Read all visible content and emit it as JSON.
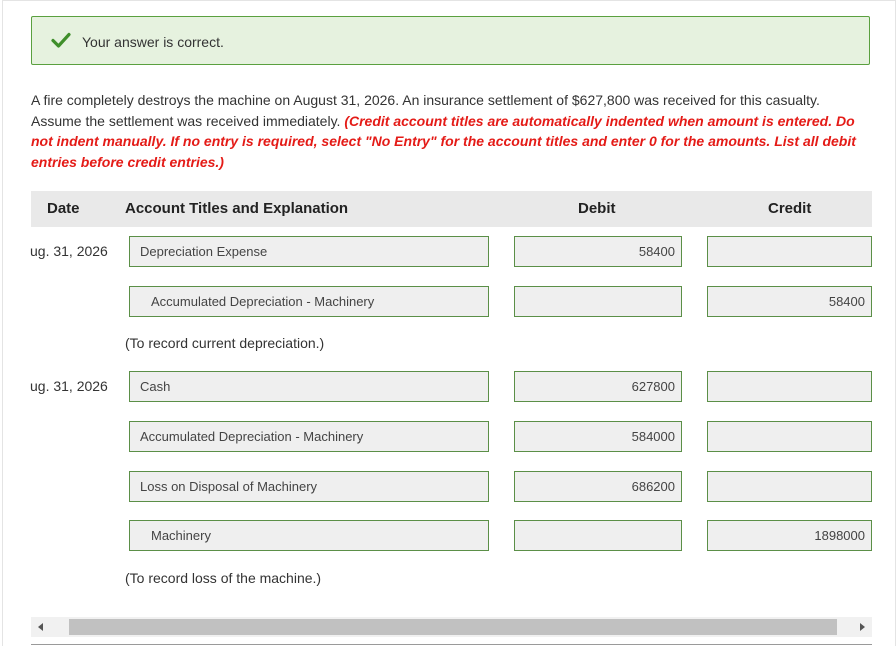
{
  "banner": {
    "message": "Your answer is correct.",
    "color": "#5aa03f"
  },
  "problem": {
    "text": "A fire completely destroys the machine on August 31, 2026. An insurance settlement of $627,800 was received for this casualty. Assume the settlement was received immediately.",
    "instructions": "(Credit account titles are automatically indented when amount is entered. Do not indent manually. If no entry is required, select \"No Entry\" for the account titles and enter 0 for the amounts. List all debit entries before credit entries.)"
  },
  "table": {
    "headers": {
      "date": "Date",
      "account": "Account Titles and Explanation",
      "debit": "Debit",
      "credit": "Credit"
    },
    "entry1": {
      "date": "ug. 31, 2026",
      "rows": [
        {
          "account": "Depreciation Expense",
          "debit": "58400",
          "credit": ""
        },
        {
          "account": "Accumulated Depreciation - Machinery",
          "debit": "",
          "credit": "58400"
        }
      ],
      "note": "(To record current depreciation.)"
    },
    "entry2": {
      "date": "ug. 31, 2026",
      "rows": [
        {
          "account": "Cash",
          "debit": "627800",
          "credit": ""
        },
        {
          "account": "Accumulated Depreciation - Machinery",
          "debit": "584000",
          "credit": ""
        },
        {
          "account": "Loss on Disposal of Machinery",
          "debit": "686200",
          "credit": ""
        },
        {
          "account": "Machinery",
          "debit": "",
          "credit": "1898000"
        }
      ],
      "note": "(To record loss of the machine.)"
    }
  },
  "icons": {
    "check": "check-icon",
    "scroll_left": "arrow-left-icon",
    "scroll_right": "arrow-right-icon"
  }
}
